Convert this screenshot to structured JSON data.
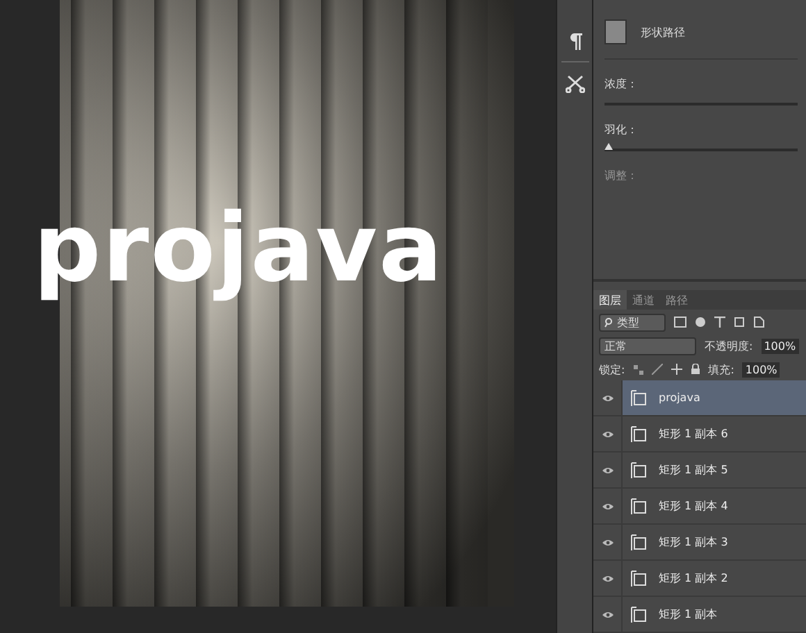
{
  "canvas": {
    "text": "projava"
  },
  "properties": {
    "mask_type": "形状路径",
    "density_label": "浓度：",
    "feather": {
      "label": "羽化：",
      "level": 0
    },
    "adjust_label": "调整："
  },
  "layers_panel": {
    "tabs": [
      {
        "label": "图层",
        "selected": true
      },
      {
        "label": "通道",
        "selected": false
      },
      {
        "label": "路径",
        "selected": false
      }
    ],
    "filter": "类型",
    "blend_mode": "正常",
    "opacity_label": "不透明度:",
    "opacity": "100%",
    "lock_label": "锁定:",
    "fill_label": "填充:",
    "fill": "100%",
    "layers": [
      {
        "name": "projava",
        "selected": true
      },
      {
        "name": "矩形 1 副本 6",
        "selected": false
      },
      {
        "name": "矩形 1 副本 5",
        "selected": false
      },
      {
        "name": "矩形 1 副本 4",
        "selected": false
      },
      {
        "name": "矩形 1 副本 3",
        "selected": false
      },
      {
        "name": "矩形 1 副本 2",
        "selected": false
      },
      {
        "name": "矩形 1 副本",
        "selected": false
      }
    ]
  }
}
